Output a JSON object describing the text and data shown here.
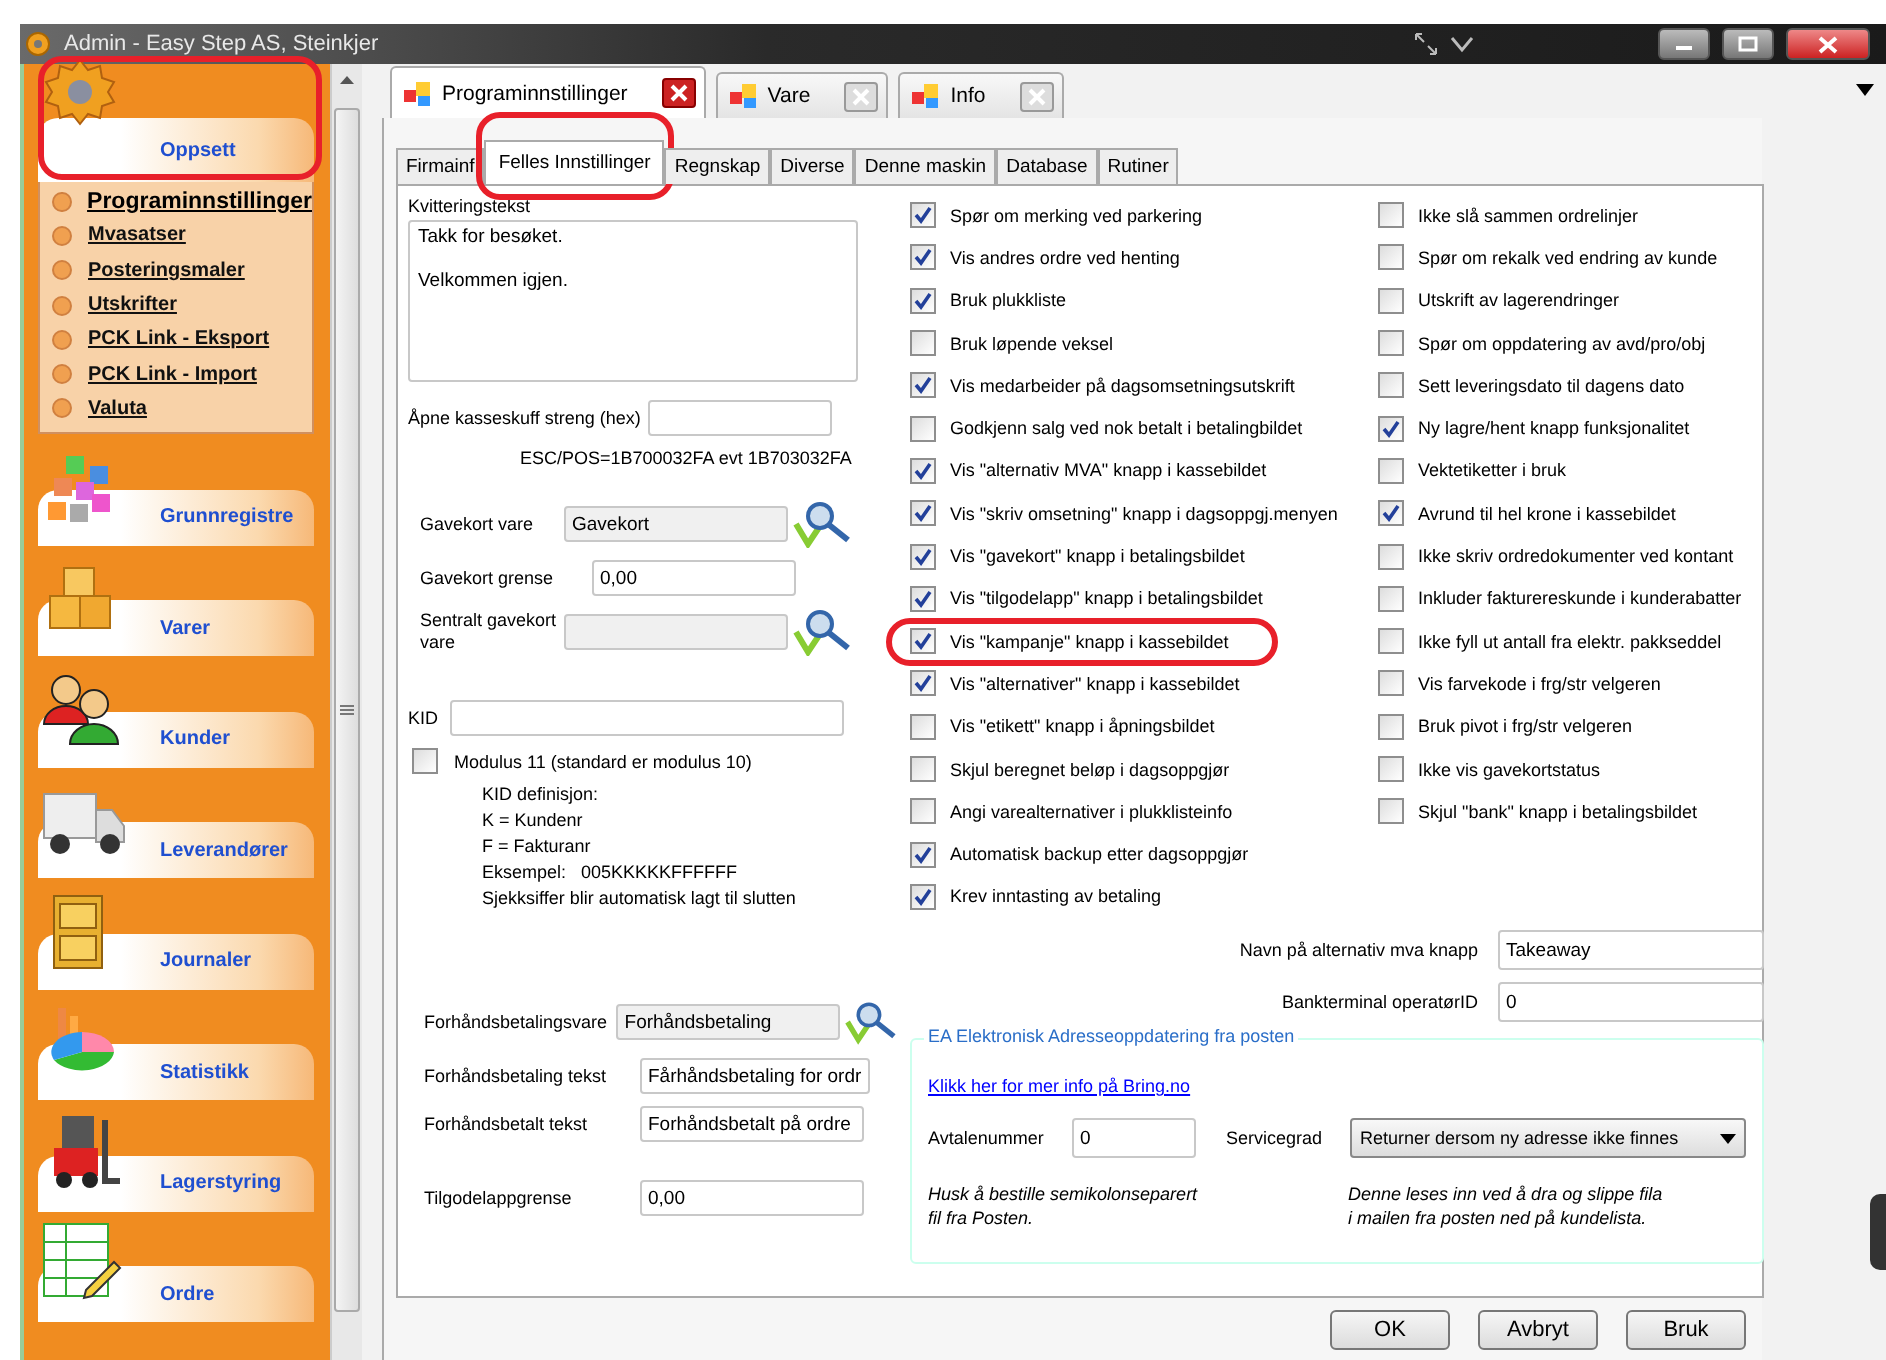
{
  "window": {
    "title": "Admin - Easy Step AS, Steinkjer"
  },
  "sidebar": {
    "groups": [
      {
        "label": "Oppsett",
        "expanded": true,
        "highlighted": true,
        "items": [
          {
            "label": "Programinnstillinger",
            "selected": true
          },
          {
            "label": "Mvasatser",
            "selected": false
          },
          {
            "label": "Posteringsmaler",
            "selected": false
          },
          {
            "label": "Utskrifter",
            "selected": false
          },
          {
            "label": "PCK Link - Eksport",
            "selected": false
          },
          {
            "label": "PCK Link - Import",
            "selected": false
          },
          {
            "label": "Valuta",
            "selected": false
          }
        ]
      },
      {
        "label": "Grunnregistre",
        "expanded": false,
        "highlighted": false
      },
      {
        "label": "Varer",
        "expanded": false,
        "highlighted": false
      },
      {
        "label": "Kunder",
        "expanded": false,
        "highlighted": false
      },
      {
        "label": "Leverandører",
        "expanded": false,
        "highlighted": false
      },
      {
        "label": "Journaler",
        "expanded": false,
        "highlighted": false
      },
      {
        "label": "Statistikk",
        "expanded": false,
        "highlighted": false
      },
      {
        "label": "Lagerstyring",
        "expanded": false,
        "highlighted": false
      },
      {
        "label": "Ordre",
        "expanded": false,
        "highlighted": false
      }
    ]
  },
  "document_tabs": [
    {
      "label": "Programinnstillinger",
      "selected": true
    },
    {
      "label": "Vare",
      "selected": false
    },
    {
      "label": "Info",
      "selected": false
    }
  ],
  "settings_tabs": [
    {
      "label": "Firmainf",
      "selected": false,
      "highlighted": false
    },
    {
      "label": "Felles Innstillinger",
      "selected": true,
      "highlighted": true
    },
    {
      "label": "Regnskap",
      "selected": false,
      "highlighted": false
    },
    {
      "label": "Diverse",
      "selected": false,
      "highlighted": false
    },
    {
      "label": "Denne maskin",
      "selected": false,
      "highlighted": false
    },
    {
      "label": "Database",
      "selected": false,
      "highlighted": false
    },
    {
      "label": "Rutiner",
      "selected": false,
      "highlighted": false
    }
  ],
  "receipt": {
    "label": "Kvitteringstekst",
    "value": "Takk for besøket.\n\nVelkommen igjen."
  },
  "drawer": {
    "label": "Åpne kasseskuff streng (hex)",
    "hint": "ESC/POS=1B700032FA evt 1B703032FA"
  },
  "gift_fields": [
    {
      "label": "Gavekort vare",
      "value": "Gavekort",
      "kind": "lookup"
    },
    {
      "label": "Gavekort grense",
      "value": "0,00",
      "kind": "input"
    },
    {
      "label": "Sentralt gavekort vare",
      "kind": "lookup"
    }
  ],
  "kid": {
    "label": "KID"
  },
  "modulus": {
    "label": "Modulus 11  (standard er modulus 10)",
    "checked": false
  },
  "kid_help": [
    "KID definisjon:",
    "K = Kundenr",
    "F = Fakturanr",
    "Eksempel:   005KKKKKFFFFFF",
    "Sjekksiffer blir automatisk lagt til slutten"
  ],
  "prepay_fields": [
    {
      "label": "Forhåndsbetalingsvare",
      "value": "Forhåndsbetaling",
      "kind": "lookup"
    },
    {
      "label": "Forhåndsbetaling tekst",
      "value": "Fårhåndsbetaling for ordr",
      "kind": "input"
    },
    {
      "label": "Forhåndsbetalt tekst",
      "value": "Forhåndsbetalt på ordre",
      "kind": "input"
    }
  ],
  "credit_limit": {
    "label": "Tilgodelappgrense",
    "value": "0,00"
  },
  "options_left": [
    {
      "label": "Spør om merking ved parkering",
      "checked": true,
      "highlighted": false
    },
    {
      "label": "Vis andres ordre ved henting",
      "checked": true,
      "highlighted": false
    },
    {
      "label": "Bruk plukkliste",
      "checked": true,
      "highlighted": false
    },
    {
      "label": "Bruk løpende veksel",
      "checked": false,
      "highlighted": false
    },
    {
      "label": "Vis medarbeider på dagsomsetningsutskrift",
      "checked": true,
      "highlighted": false
    },
    {
      "label": "Godkjenn salg ved nok betalt i betalingbildet",
      "checked": false,
      "highlighted": false
    },
    {
      "label": "Vis \"alternativ MVA\" knapp i kassebildet",
      "checked": true,
      "highlighted": false
    },
    {
      "label": "Vis \"skriv omsetning\" knapp i dagsoppgj.menyen",
      "checked": true,
      "highlighted": false
    },
    {
      "label": "Vis \"gavekort\" knapp i betalingsbildet",
      "checked": true,
      "highlighted": false
    },
    {
      "label": "Vis \"tilgodelapp\" knapp i betalingsbildet",
      "checked": true,
      "highlighted": false
    },
    {
      "label": "Vis \"kampanje\" knapp i kassebildet",
      "checked": true,
      "highlighted": true
    },
    {
      "label": "Vis \"alternativer\" knapp i kassebildet",
      "checked": true,
      "highlighted": false
    },
    {
      "label": "Vis \"etikett\" knapp i åpningsbildet",
      "checked": false,
      "highlighted": false
    },
    {
      "label": "Skjul beregnet beløp i dagsoppgjør",
      "checked": false,
      "highlighted": false
    },
    {
      "label": "Angi varealternativer i plukklisteinfo",
      "checked": false,
      "highlighted": false
    },
    {
      "label": "Automatisk backup etter dagsoppgjør",
      "checked": true,
      "highlighted": false
    },
    {
      "label": "Krev inntasting av betaling",
      "checked": true,
      "highlighted": false
    }
  ],
  "options_right": [
    {
      "label": "Ikke slå sammen ordrelinjer",
      "checked": false
    },
    {
      "label": "Spør om rekalk ved endring av kunde",
      "checked": false
    },
    {
      "label": "Utskrift av lagerendringer",
      "checked": false
    },
    {
      "label": "Spør om oppdatering av avd/pro/obj",
      "checked": false
    },
    {
      "label": "Sett leveringsdato til dagens dato",
      "checked": false
    },
    {
      "label": "Ny lagre/hent knapp funksjonalitet",
      "checked": true
    },
    {
      "label": "Vektetiketter i bruk",
      "checked": false
    },
    {
      "label": "Avrund til hel krone i kassebildet",
      "checked": true
    },
    {
      "label": "Ikke skriv ordredokumenter ved kontant",
      "checked": false
    },
    {
      "label": "Inkluder fakturereskunde i kunderabatter",
      "checked": false
    },
    {
      "label": "Ikke fyll ut antall fra elektr. pakkseddel",
      "checked": false
    },
    {
      "label": "Vis farvekode i frg/str velgeren",
      "checked": false
    },
    {
      "label": "Bruk pivot i frg/str velgeren",
      "checked": false
    },
    {
      "label": "Ikke vis gavekortstatus",
      "checked": false
    },
    {
      "label": "Skjul \"bank\" knapp i betalingsbildet",
      "checked": false
    }
  ],
  "extra_fields": [
    {
      "label": "Navn på alternativ mva knapp",
      "value": "Takeaway"
    },
    {
      "label": "Bankterminal operatørID",
      "value": "0"
    }
  ],
  "address_group": {
    "title": "EA Elektronisk Adresseoppdatering fra posten",
    "link": "Klikk her for mer info på Bring.no",
    "agreement": {
      "label": "Avtalenummer",
      "value": "0"
    },
    "service": {
      "label": "Servicegrad",
      "value": "Returner dersom ny adresse ikke finnes"
    },
    "notes": [
      "Husk å bestille semikolonseparert\nfil fra Posten.",
      "Denne leses inn ved å dra og slippe fila\ni mailen fra posten ned på kundelista."
    ]
  },
  "buttons": [
    "OK",
    "Avbryt",
    "Bruk"
  ]
}
